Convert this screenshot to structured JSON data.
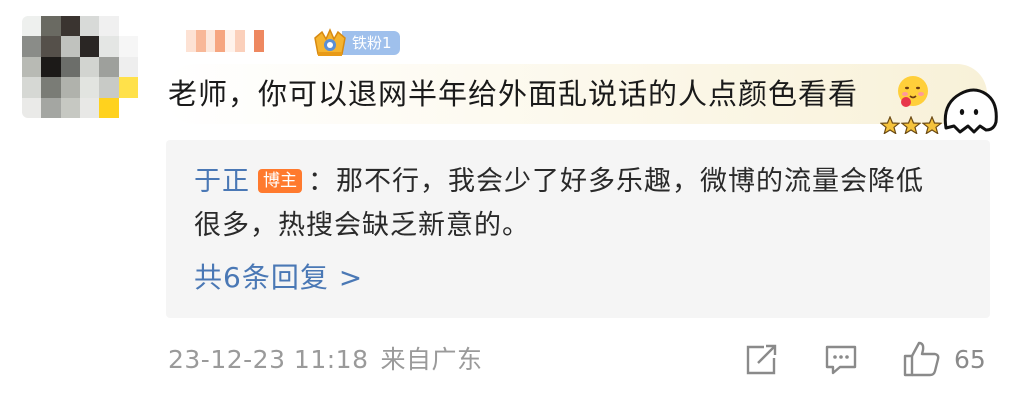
{
  "comment": {
    "fan_badge_label": "铁粉1",
    "text": "老师，你可以退网半年给外面乱说话的人点颜色看看"
  },
  "reply": {
    "author": "于正",
    "author_tag": "博主",
    "line1": "：那不行，我会少了好多乐趣，微博的流量会降低",
    "line2": "很多，热搜会缺乏新意的。",
    "view_more": "共6条回复 >"
  },
  "footer": {
    "timestamp": "23-12-23 11:18",
    "location": "来自广东",
    "like_count": "65"
  },
  "icons": [
    "crown-icon",
    "emoji-icon",
    "ghost-sticker-icon",
    "star-icon",
    "share-icon",
    "comment-icon",
    "like-icon"
  ],
  "colors": {
    "link_blue": "#4a78b5",
    "blogger_tag": "#ff7a2e",
    "fan_badge": "#9fc0ec",
    "reply_bg": "#f5f5f5",
    "meta_gray": "#9a9a9a"
  }
}
